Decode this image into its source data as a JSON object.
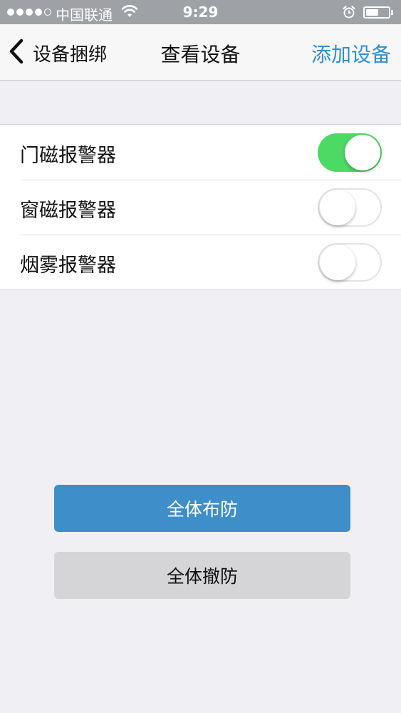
{
  "status_bar": {
    "carrier": "中国联通",
    "time": "9:29",
    "signal_bars_filled": 4,
    "signal_bars_total": 5,
    "battery_level": 0.55
  },
  "nav": {
    "back_label": "设备捆绑",
    "title": "查看设备",
    "right_action": "添加设备",
    "accent_color": "#2f8fd0"
  },
  "devices": [
    {
      "label": "门磁报警器",
      "enabled": true
    },
    {
      "label": "窗磁报警器",
      "enabled": false
    },
    {
      "label": "烟雾报警器",
      "enabled": false
    }
  ],
  "actions": {
    "arm_all": "全体布防",
    "disarm_all": "全体撤防"
  },
  "colors": {
    "toggle_on": "#4cd964",
    "arm_button": "#3d8ec9",
    "disarm_button": "#d5d5d8"
  },
  "icons": [
    "signal-icon",
    "wifi-icon",
    "alarm-clock-icon",
    "battery-icon",
    "chevron-left-icon"
  ]
}
